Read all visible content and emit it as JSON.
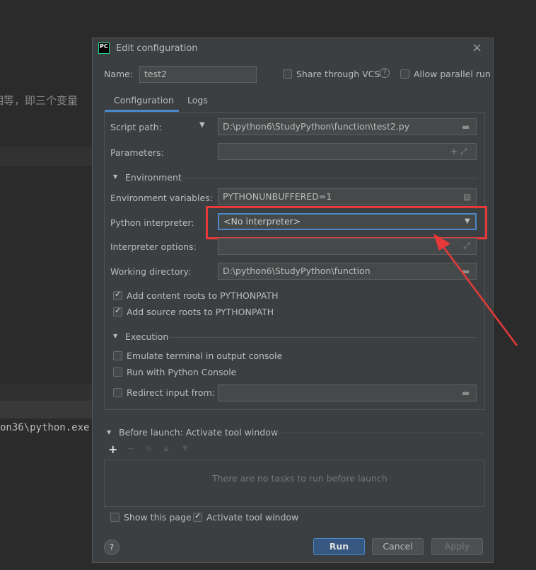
{
  "background": {
    "chinese_text": "相等，即三个变量",
    "console_text": "on36\\python.exe"
  },
  "dialog": {
    "title": "Edit configuration",
    "logo": "PC",
    "name_label": "Name:",
    "name_value": "test2",
    "share_vcs": "Share through VCS",
    "allow_parallel": "Allow parallel run",
    "tabs": [
      "Configuration",
      "Logs"
    ],
    "script_path_label": "Script path:",
    "script_path": "D:\\python6\\StudyPython\\function\\test2.py",
    "parameters_label": "Parameters:",
    "environment_section": "Environment",
    "env_vars_label": "Environment variables:",
    "env_vars": "PYTHONUNBUFFERED=1",
    "interpreter_label": "Python interpreter:",
    "interpreter": "<No interpreter>",
    "interp_options_label": "Interpreter options:",
    "working_dir_label": "Working directory:",
    "working_dir": "D:\\python6\\StudyPython\\function",
    "add_content_roots": "Add content roots to PYTHONPATH",
    "add_source_roots": "Add source roots to PYTHONPATH",
    "execution_section": "Execution",
    "emulate_terminal": "Emulate terminal in output console",
    "run_python_console": "Run with Python Console",
    "redirect_input": "Redirect input from:",
    "before_launch": "Before launch: Activate tool window",
    "no_tasks": "There are no tasks to run before launch",
    "show_page": "Show this page",
    "activate_tool": "Activate tool window",
    "run": "Run",
    "cancel": "Cancel",
    "apply": "Apply"
  },
  "colors": {
    "accent": "#4a88c7",
    "highlight": "#e8393a",
    "primary_button": "#365880"
  }
}
